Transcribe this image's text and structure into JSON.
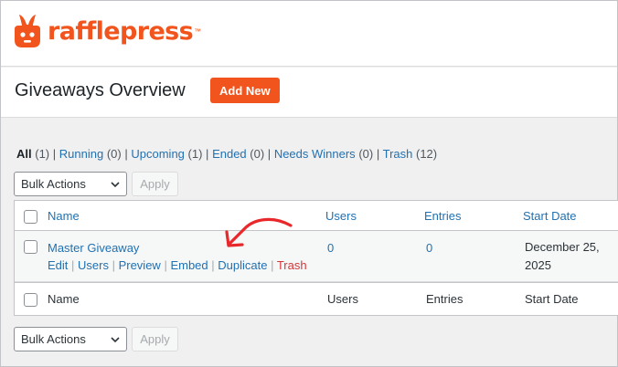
{
  "brand": {
    "name": "rafflepress",
    "tm": "™"
  },
  "header": {
    "title": "Giveaways Overview",
    "add_new": "Add New"
  },
  "filters": [
    {
      "label": "All",
      "count": "(1)",
      "current": true
    },
    {
      "label": "Running",
      "count": "(0)"
    },
    {
      "label": "Upcoming",
      "count": "(1)"
    },
    {
      "label": "Ended",
      "count": "(0)"
    },
    {
      "label": "Needs Winners",
      "count": "(0)"
    },
    {
      "label": "Trash",
      "count": "(12)"
    }
  ],
  "bulk_top": {
    "select": "Bulk Actions",
    "apply": "Apply"
  },
  "bulk_bottom": {
    "select": "Bulk Actions",
    "apply": "Apply"
  },
  "table": {
    "columns": [
      "Name",
      "Users",
      "Entries",
      "Start Date"
    ],
    "rows": [
      {
        "name": "Master Giveaway",
        "users": "0",
        "entries": "0",
        "start_date_line1": "December 25,",
        "start_date_line2": "2025",
        "actions": [
          "Edit",
          "Users",
          "Preview",
          "Embed",
          "Duplicate",
          "Trash"
        ]
      }
    ]
  },
  "colors": {
    "brand": "#f1541c",
    "link": "#2271b1",
    "trash": "#d63638",
    "annotation": "#e8282b"
  }
}
